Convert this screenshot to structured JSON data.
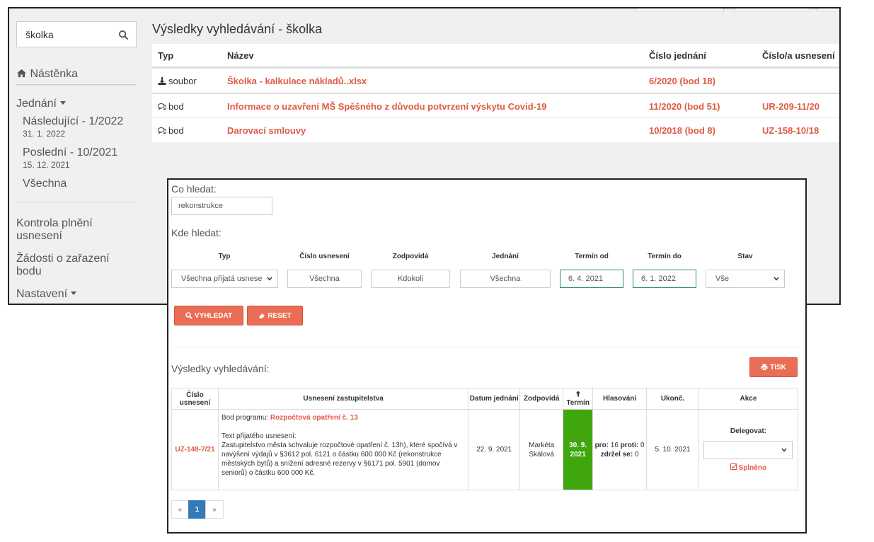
{
  "search": {
    "value": "školka"
  },
  "sidebar": {
    "dashboard": "Nástěnka",
    "meetings": "Jednání",
    "next_label": "Následující - 1/2022",
    "next_date": "31. 1. 2022",
    "last_label": "Poslední - 10/2021",
    "last_date": "15. 12. 2021",
    "all_label": "Všechna",
    "control": "Kontrola plnění usnesení",
    "requests": "Žádosti o zařazení bodu",
    "settings": "Nastavení"
  },
  "results": {
    "title": "Výsledky vyhledávání - školka",
    "headers": {
      "typ": "Typ",
      "nazev": "Název",
      "cislo_jednani": "Číslo jednání",
      "cislo_usneseni": "Číslo/a usnesení"
    },
    "rows": [
      {
        "typ": "soubor",
        "nazev": "Školka - kalkulace nákladů..xlsx",
        "cj": "6/2020 (bod 18)",
        "cu": ""
      },
      {
        "typ": "bod",
        "nazev": "Informace o uzavření MŠ Spěšného z důvodu potvrzení výskytu Covid-19",
        "cj": "11/2020 (bod 51)",
        "cu": "UR-209-11/20"
      },
      {
        "typ": "bod",
        "nazev": "Darovací smlouvy",
        "cj": "10/2018 (bod 8)",
        "cu": "UZ-158-10/18"
      }
    ]
  },
  "form": {
    "co_hledat_label": "Co hledat:",
    "co_hledat_value": "rekonstrukce",
    "kde_hledat_label": "Kde hledat:",
    "columns": {
      "typ": "Typ",
      "cislo": "Číslo usnesení",
      "zodpovida": "Zodpovídá",
      "jednani": "Jednání",
      "termin_od": "Termín od",
      "termin_do": "Termín do",
      "stav": "Stav"
    },
    "values": {
      "typ": "Všechna přijatá usnese",
      "cislo": "Všechna",
      "zodpovida": "Kdokoli",
      "jednani": "Všechna",
      "termin_od": "6. 4. 2021",
      "termin_do": "6. 1. 2022",
      "stav": "Vše"
    },
    "search_btn": "VYHLEDAT",
    "reset_btn": "RESET"
  },
  "list": {
    "title": "Výsledky vyhledávání:",
    "print_btn": "TISK",
    "headers": {
      "cislo": "Číslo usnesení",
      "usneseni": "Usnesení zastupitelstva",
      "datum": "Datum jednání",
      "zodpovida": "Zodpovídá",
      "termin": "Termín",
      "hlasovani": "Hlasování",
      "ukonc": "Ukonč.",
      "akce": "Akce"
    },
    "row": {
      "cislo": "UZ-148-7/21",
      "bod_prefix": "Bod programu:",
      "bod_link": "Rozpočtová opatření č. 13",
      "text_label": "Text přijatého usnesení:",
      "text_body": "Zastupitelstvo města schvaluje rozpočtové opatření č. 13h), které spočívá v navýšení výdajů v §3612 pol. 6121 o částku 600 000 Kč (rekonstrukce městských bytů) a snížení adresné rezervy v §6171 pol. 5901 (domov seniorů) o částku 600 000 Kč.",
      "datum": "22. 9. 2021",
      "zodpovida_1": "Markéta",
      "zodpovida_2": "Skálová",
      "termin_1": "30. 9.",
      "termin_2": "2021",
      "pro_label": "pro:",
      "pro": "16",
      "proti_label": "proti:",
      "proti": "0",
      "zdrzel_label": "zdržel se:",
      "zdrzel": "0",
      "ukonc": "5. 10. 2021",
      "delegovat": "Delegovat:",
      "splneno": "Splněno"
    },
    "pager": {
      "prev": "«",
      "page": "1",
      "next": "»"
    }
  },
  "colors": {
    "accent_red": "#e05a46",
    "button_red": "#ea6d55",
    "termin_green": "#3fa70d",
    "pager_blue": "#337ab7"
  }
}
